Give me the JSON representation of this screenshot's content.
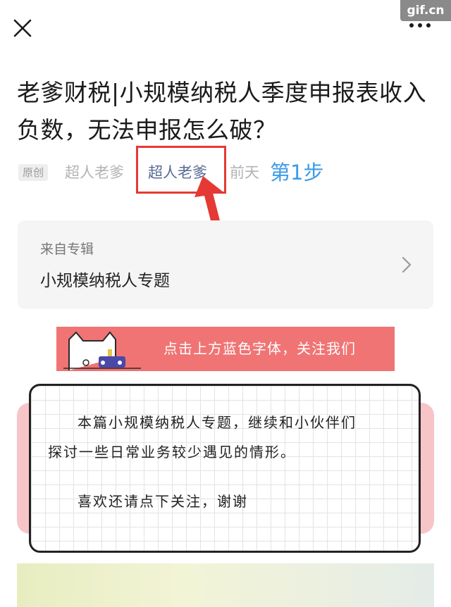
{
  "watermark": "gif.cn",
  "topbar": {
    "close_icon": "close-icon",
    "more_icon": "more-icon"
  },
  "article": {
    "title": "老爹财税|小规模纳税人季度申报表收入负数，无法申报怎么破？",
    "original_badge": "原创",
    "author_name": "超人老爹",
    "account_name": "超人老爹",
    "publish_time": "前天"
  },
  "annotation": {
    "step_label": "第1步",
    "highlight_color": "#e53935"
  },
  "album": {
    "source_label": "来自专辑",
    "name": "小规模纳税人专题",
    "chevron_icon": "chevron-right-icon"
  },
  "follow_banner": {
    "text": "点击上方蓝色字体，关注我们",
    "background": "#f07474"
  },
  "intro_card": {
    "line1": "本篇小规模纳税人专题，继续和小伙伴们",
    "line2": "探讨一些日常业务较少遇见的情形。",
    "line3": "喜欢还请点下关注，谢谢"
  },
  "colors": {
    "link": "#576b95",
    "step": "#3d9be9"
  }
}
